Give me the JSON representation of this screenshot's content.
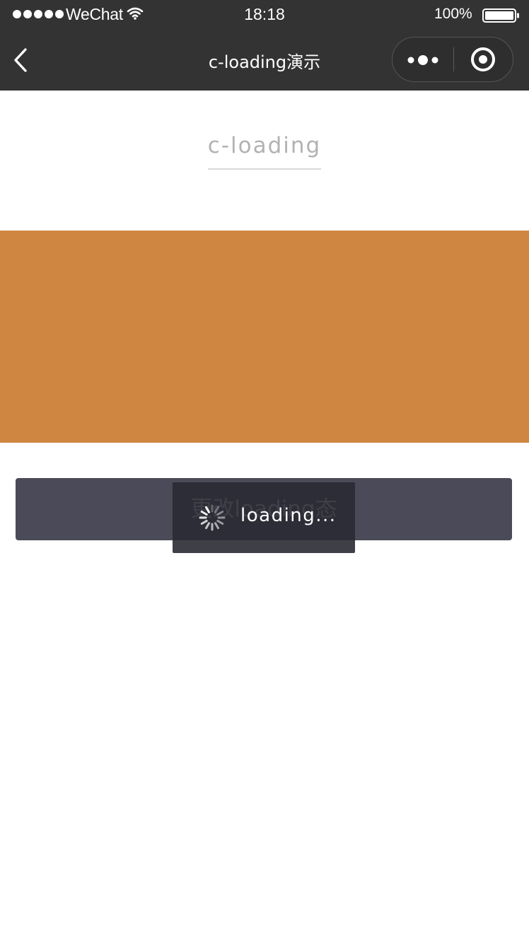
{
  "status_bar": {
    "carrier": "WeChat",
    "time": "18:18",
    "battery": "100%"
  },
  "nav": {
    "title": "c-loading演示"
  },
  "content": {
    "heading": "c-loading",
    "block_color": "#cf8640",
    "button_label": "更改loading态"
  },
  "loading": {
    "text": "loading..."
  }
}
